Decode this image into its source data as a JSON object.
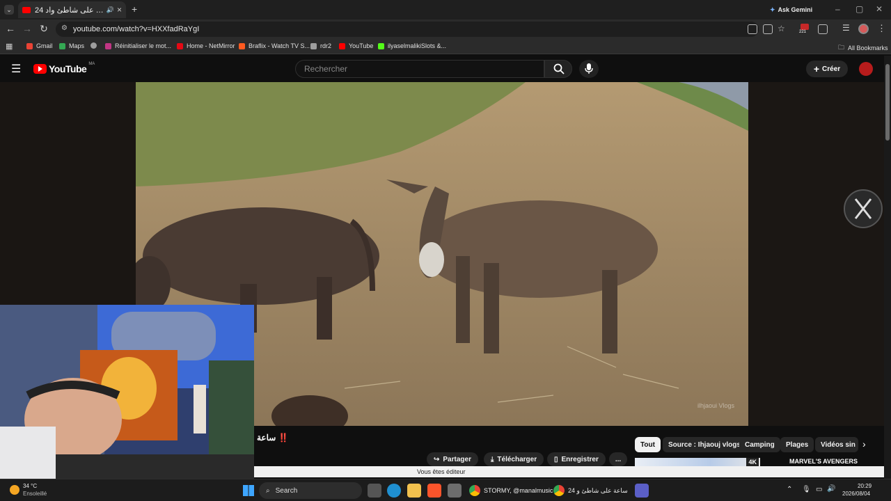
{
  "browser": {
    "tab": {
      "title": "24 ساعة على شاطئ واد",
      "close": "×"
    },
    "new_tab": "+",
    "ask_gemini": "Ask Gemini",
    "url": "youtube.com/watch?v=HXXfadRaYgI",
    "badge_count": "221"
  },
  "bookmarks": {
    "items": [
      {
        "label": "Gmail",
        "color": "#ea4335"
      },
      {
        "label": "Maps",
        "color": "#34a853"
      },
      {
        "label": "Réinitialiser le mot...",
        "color": "#c13584"
      },
      {
        "label": "Home - NetMirror",
        "color": "#e50914"
      },
      {
        "label": "Braflix - Watch TV S...",
        "color": "#ff5a1f"
      },
      {
        "label": "rdr2",
        "color": "#9e9e9e"
      },
      {
        "label": "YouTube",
        "color": "#ff0000"
      },
      {
        "label": "ilyaselmalikiSlots &...",
        "color": "#53fc18"
      }
    ],
    "all_bookmarks": "All Bookmarks"
  },
  "youtube": {
    "logo": "YouTube",
    "region": "MA",
    "search_placeholder": "Rechercher",
    "create_label": "Créer"
  },
  "video": {
    "watermark": "ilhjaoui Vlogs",
    "title_fragment": "ساعة ‼️"
  },
  "chips": [
    "Tout",
    "Source : Ihjaouj vlogs",
    "Camping",
    "Plages",
    "Vidéos sin"
  ],
  "actions": {
    "share": "Partager",
    "download": "Télécharger",
    "save": "Enregistrer",
    "more": "..."
  },
  "recommendation": {
    "badge": "4K",
    "title": "MARVEL'S AVENGERS"
  },
  "editor_notice": "Vous êtes éditeur",
  "taskbar": {
    "weather_temp": "34 °C",
    "weather_desc": "Ensoleillé",
    "search_label": "Search",
    "app_chrome1": "STORMY, @manalmusic",
    "app_chrome2": "24 ساعة على شاطئ و",
    "time": "20:29",
    "date": "2026/08/04"
  },
  "colors": {
    "youtube_red": "#ff0000",
    "accent": "#3ea6ff"
  }
}
